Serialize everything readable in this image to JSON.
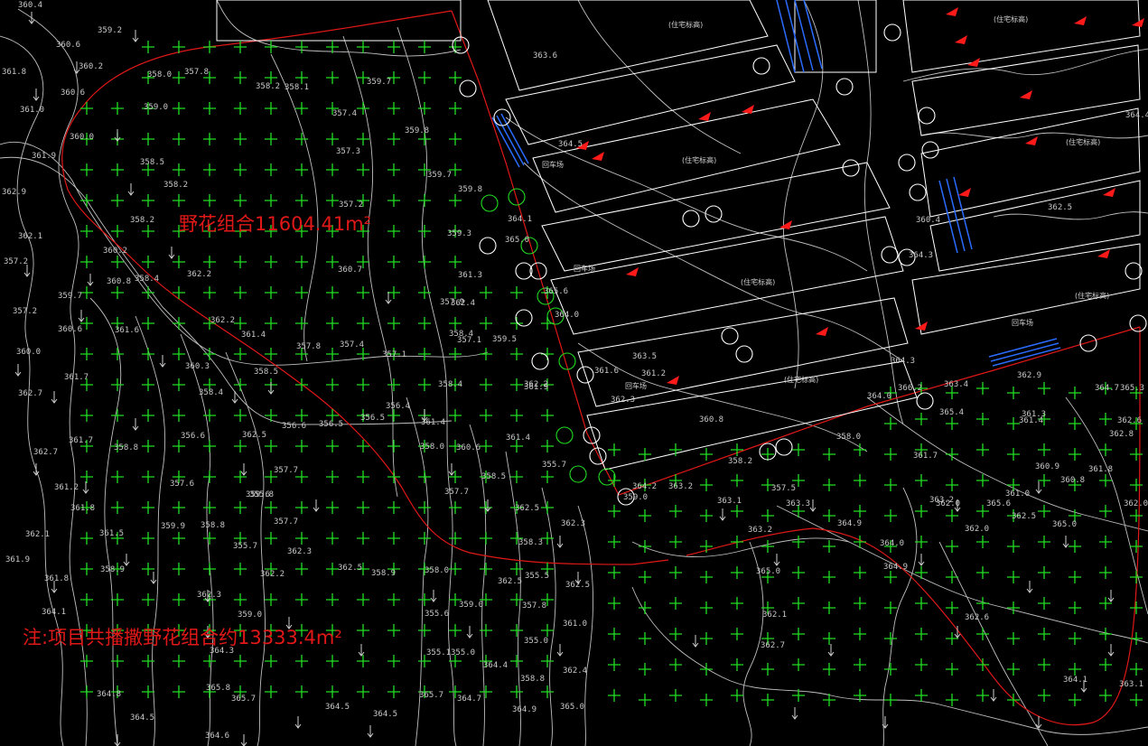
{
  "labels": {
    "main_area": "野花组合11604.41m²",
    "note": "注:项目共播撒野花组合约13333.4m²"
  },
  "colors": {
    "background": "#000000",
    "contour": "#bfbfbf",
    "boundary": "#e01818",
    "marker": "#22dd22",
    "building": "#ffffff",
    "parking": "#2a6cff",
    "arrow": "#ff1a1a"
  },
  "icons": {
    "planting_marker": "green-plus-icon",
    "tree": "circle-icon",
    "slope_arrow": "down-arrow-icon",
    "fire_marker": "red-triangle-icon"
  },
  "building_tags": [
    "(住宅标高)",
    "回车场"
  ],
  "elevations": [
    "360.4",
    "359.2",
    "360.6",
    "361.8",
    "360.2",
    "358.0",
    "357.8",
    "358.2",
    "358.1",
    "359.7",
    "361.0",
    "360.6",
    "360.0",
    "359.0",
    "357.4",
    "359.8",
    "361.9",
    "358.5",
    "357.3",
    "359.7",
    "362.9",
    "358.2",
    "357.2",
    "359.8",
    "358.2",
    "359.3",
    "362.1",
    "360.2",
    "358.4",
    "361.3",
    "357.2",
    "360.8",
    "362.2",
    "360.7",
    "359.7",
    "357.9",
    "357.2",
    "360.6",
    "361.6",
    "362.2",
    "361.4",
    "357.8",
    "357.4",
    "357.1",
    "357.1",
    "359.5",
    "362.4",
    "360.0",
    "361.7",
    "360.3",
    "358.5",
    "358.4",
    "358.4",
    "362.2",
    "362.7",
    "361.7",
    "358.4",
    "356.6",
    "356.5",
    "356.5",
    "356.4",
    "361.4",
    "360.6",
    "358.8",
    "356.6",
    "362.5",
    "361.9",
    "361.4",
    "361.2",
    "357.6",
    "359.6",
    "358.5",
    "362.7",
    "359.9",
    "358.8",
    "358.0",
    "357.7",
    "362.1",
    "361.8",
    "357.7",
    "355.8",
    "355.7",
    "361.9",
    "361.5",
    "357.7",
    "355.7",
    "362.3",
    "362.5",
    "358.3",
    "355.5",
    "362.3",
    "362.5",
    "361.8",
    "358.9",
    "362.2",
    "362.5",
    "358.9",
    "358.0",
    "357.8",
    "361.0",
    "362.3",
    "359.0",
    "355.6",
    "359.0",
    "362.5",
    "355.0",
    "355.0",
    "362.4",
    "358.8",
    "355.1",
    "364.1",
    "364.3",
    "364.5",
    "364.5",
    "364.4",
    "364.9",
    "365.0",
    "365.8",
    "365.7",
    "365.7",
    "364.7",
    "364.8",
    "364.5",
    "364.6",
    "364.2",
    "363.2",
    "363.1",
    "363.3",
    "363.2",
    "364.9",
    "364.0",
    "364.9",
    "365.0",
    "362.1",
    "362.7",
    "363.2",
    "365.6",
    "362.5",
    "365.0",
    "362.6",
    "364.1",
    "362.0",
    "363.1",
    "362.0",
    "361.4",
    "360.9",
    "360.8",
    "361.0",
    "361.8",
    "361.7",
    "362.0",
    "362.8",
    "362.9",
    "361.3",
    "362.6",
    "363.4",
    "364.7",
    "365.4",
    "365.3",
    "366.2",
    "364.3",
    "364.0",
    "364.3",
    "363.6",
    "364.5",
    "364.1",
    "365.0",
    "365.6",
    "364.0",
    "361.6",
    "361.2",
    "362.3",
    "363.5",
    "360.8",
    "358.2",
    "357.5",
    "358.0",
    "359.0",
    "360.4",
    "362.5",
    "364.4"
  ]
}
